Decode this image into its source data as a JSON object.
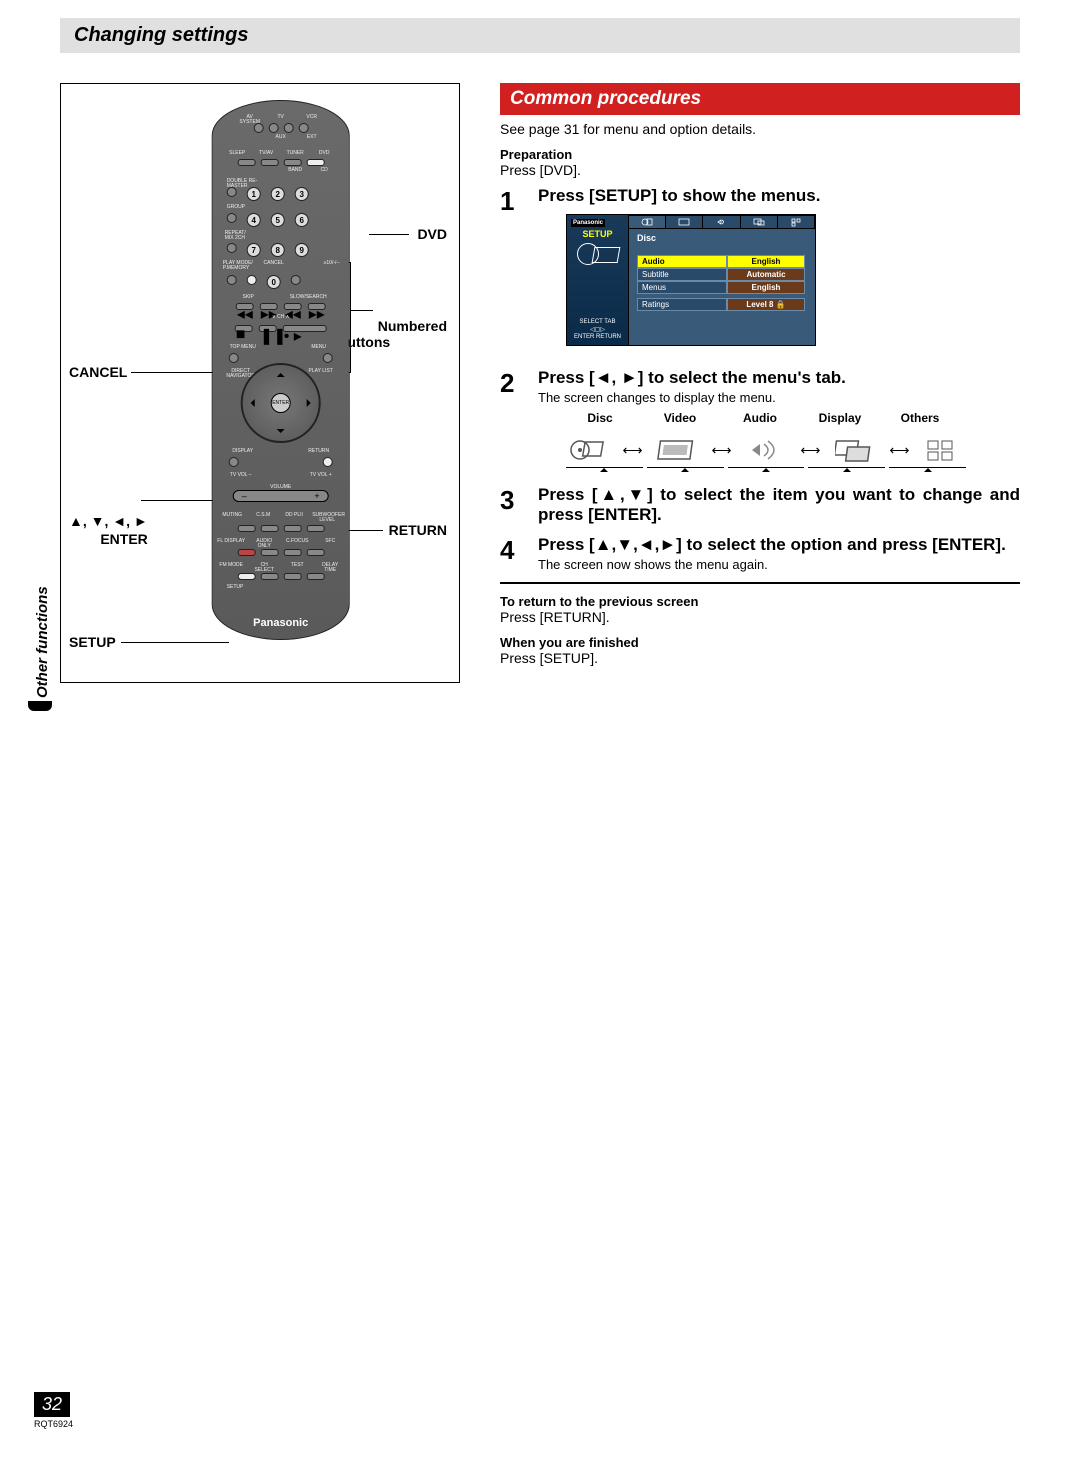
{
  "header": {
    "title": "Changing settings"
  },
  "side_tab": "Other functions",
  "footer": {
    "page_number": "32",
    "doc_code": "RQT6924"
  },
  "remote": {
    "callouts": {
      "dvd": "DVD",
      "numbered_buttons": "Numbered\nbuttons",
      "cancel": "CANCEL",
      "arrows_enter": "▲, ▼, ◄, ►\nENTER",
      "return": "RETURN",
      "setup": "SETUP"
    },
    "labels": {
      "top_row": [
        "AV SYSTEM",
        "TV",
        "VCR"
      ],
      "top_row2": [
        "",
        "AUX",
        "EXT"
      ],
      "row2": [
        "SLEEP",
        "TV/AV",
        "TUNER",
        "DVD"
      ],
      "row2b": [
        "",
        "",
        "BAND",
        "CD"
      ],
      "row3": [
        "DOUBLE RE-MASTER"
      ],
      "group": "GROUP",
      "repeat": "REPEAT/\nMIX 2CH",
      "playmode": "PLAY MODE/\nP.MEMORY",
      "cancel": "CANCEL",
      "s10": "≥10/-/--",
      "skip": "SKIP",
      "slowsearch": "SLOW/SEARCH",
      "ch": "CH",
      "topmenu": "TOP MENU",
      "menu": "MENU",
      "direct": "DIRECT\nNAVIGATOR",
      "playlist": "PLAY LIST",
      "enter": "ENTER",
      "display": "DISPLAY",
      "return": "RETURN",
      "tvvol_minus": "TV VOL –",
      "tvvol_plus": "TV VOL +",
      "volume": "VOLUME",
      "muting": "MUTING",
      "csm": "C.S.M",
      "ddpl": "DD PLII",
      "subwoofer": "SUBWOOFER\nLEVEL",
      "fl": "FL DISPLAY",
      "audioonly": "AUDIO ONLY",
      "cfocus": "C.FOCUS",
      "sfc": "SFC",
      "fmmode": "FM MODE",
      "chselect": "CH SELECT",
      "test": "TEST",
      "delaytime": "DELAY TIME",
      "setup": "SETUP",
      "brand": "Panasonic"
    },
    "num_buttons": [
      "1",
      "2",
      "3",
      "4",
      "5",
      "6",
      "7",
      "8",
      "9",
      "0"
    ]
  },
  "right": {
    "section_title": "Common procedures",
    "intro": "See page 31 for menu and option details.",
    "prep_head": "Preparation",
    "prep_body": "Press [DVD].",
    "steps": [
      {
        "n": "1",
        "main": "Press [SETUP] to show the menus."
      },
      {
        "n": "2",
        "main": "Press [◄, ►] to select the menu's tab.",
        "sub": "The screen changes to display the menu."
      },
      {
        "n": "3",
        "main": "Press [▲,▼] to select the item you want to change and press [ENTER]."
      },
      {
        "n": "4",
        "main": "Press [▲,▼,◄,►] to select the option and press [ENTER].",
        "sub": "The screen now shows the menu again."
      }
    ],
    "osd": {
      "brand": "Panasonic",
      "setup": "SETUP",
      "hint_top": "SELECT  TAB",
      "hint_nav": "◁▢▷",
      "hint_bottom": "ENTER   RETURN",
      "tab_title": "Disc",
      "rows": [
        {
          "k": "Audio",
          "v": "English"
        },
        {
          "k": "Subtitle",
          "v": "Automatic"
        },
        {
          "k": "Menus",
          "v": "English"
        }
      ],
      "rating_row": {
        "k": "Ratings",
        "v": "Level 8 🔒"
      }
    },
    "tabs": [
      "Disc",
      "Video",
      "Audio",
      "Display",
      "Others"
    ],
    "return_head": "To return to the previous screen",
    "return_body": "Press [RETURN].",
    "finish_head": "When you are finished",
    "finish_body": "Press [SETUP]."
  }
}
